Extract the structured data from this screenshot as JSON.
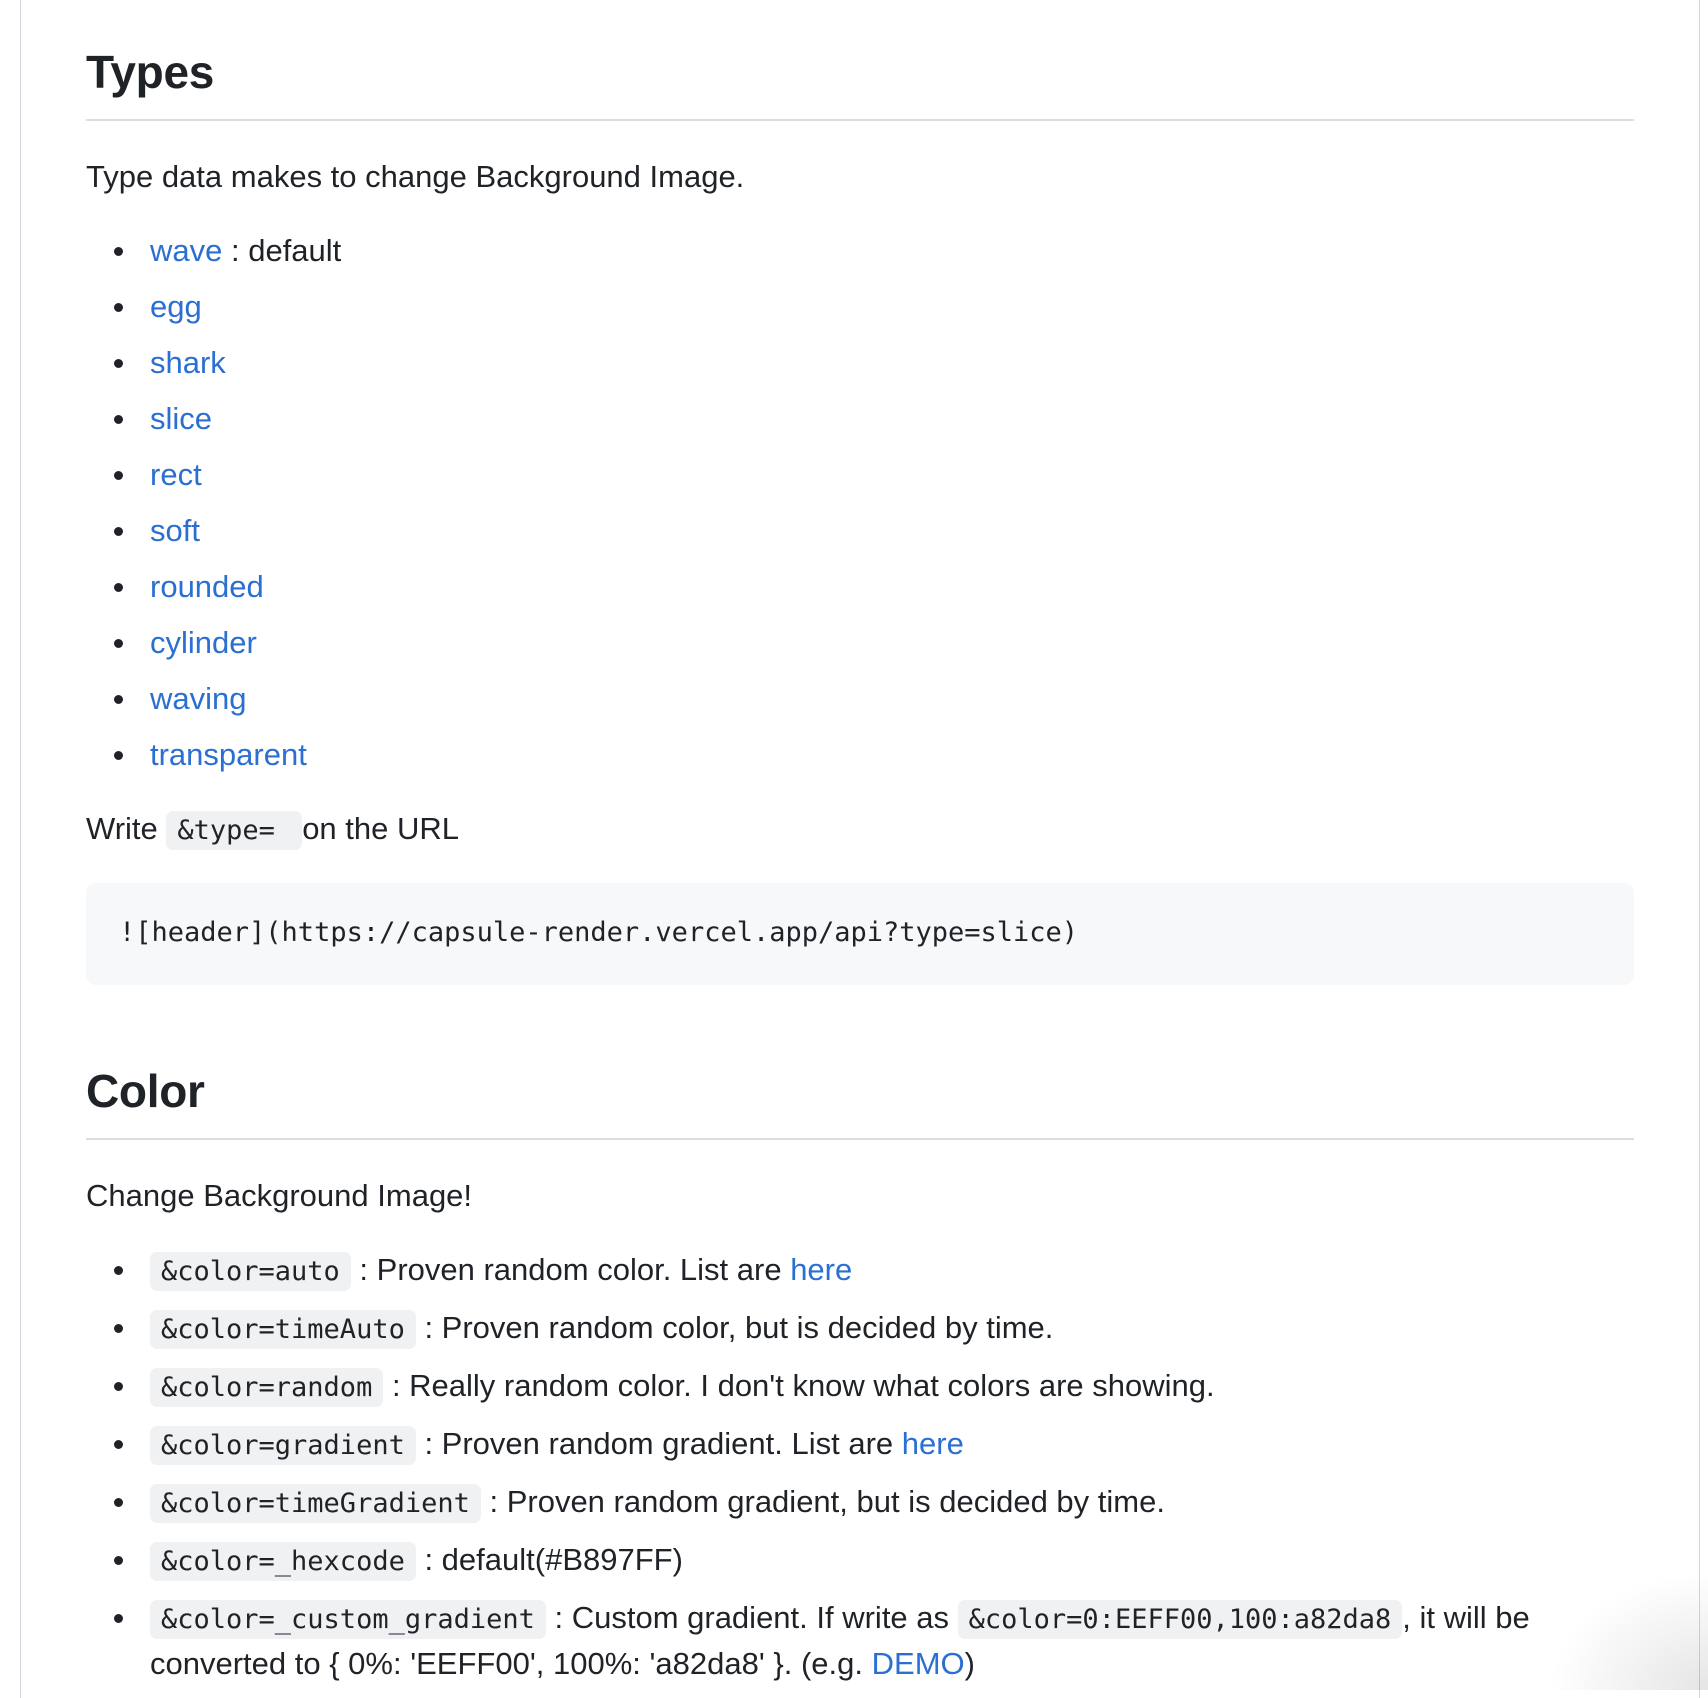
{
  "types": {
    "heading": "Types",
    "intro": "Type data makes to change Background Image.",
    "items": [
      {
        "link": "wave",
        "suffix": " : default"
      },
      {
        "link": "egg",
        "suffix": ""
      },
      {
        "link": "shark",
        "suffix": ""
      },
      {
        "link": "slice",
        "suffix": ""
      },
      {
        "link": "rect",
        "suffix": ""
      },
      {
        "link": "soft",
        "suffix": ""
      },
      {
        "link": "rounded",
        "suffix": ""
      },
      {
        "link": "cylinder",
        "suffix": ""
      },
      {
        "link": "waving",
        "suffix": ""
      },
      {
        "link": "transparent",
        "suffix": ""
      }
    ],
    "write_prefix": "Write ",
    "write_code": "&type= ",
    "write_suffix": " on the URL",
    "code_example": "![header](https://capsule-render.vercel.app/api?type=slice)"
  },
  "color": {
    "heading": "Color",
    "intro": "Change Background Image!",
    "items": [
      {
        "code": "&color=auto",
        "text": " : Proven random color. List are ",
        "link": "here"
      },
      {
        "code": "&color=timeAuto",
        "text": " : Proven random color, but is decided by time."
      },
      {
        "code": "&color=random",
        "text": " : Really random color. I don't know what colors are showing."
      },
      {
        "code": "&color=gradient",
        "text": " : Proven random gradient. List are ",
        "link": "here"
      },
      {
        "code": "&color=timeGradient",
        "text": " : Proven random gradient, but is decided by time."
      },
      {
        "code": "&color=_hexcode",
        "text": " : default(#B897FF)"
      },
      {
        "code": "&color=_custom_gradient",
        "text": " : Custom gradient. If write as ",
        "code2": "&color=0:EEFF00,100:a82da8",
        "text2": ", it will be converted to { 0%: 'EEFF00', 100%: 'a82da8' }. (e.g. ",
        "link": "DEMO",
        "text3": ")"
      }
    ]
  }
}
